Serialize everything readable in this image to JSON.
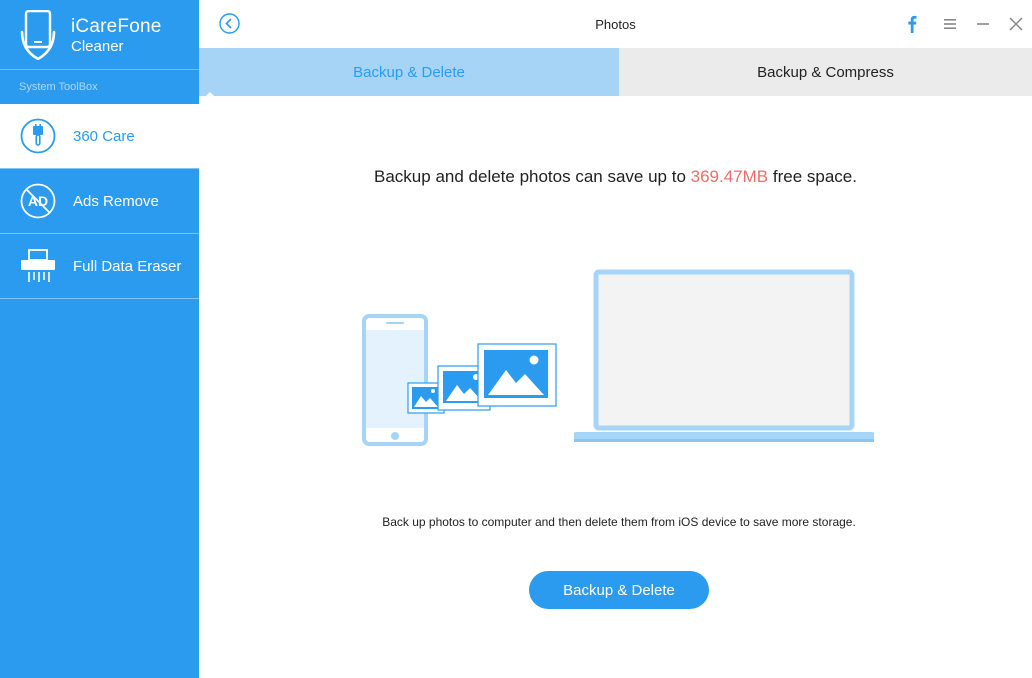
{
  "app": {
    "name": "iCareFone",
    "subtitle": "Cleaner"
  },
  "sidebar": {
    "section_label": "System ToolBox",
    "items": [
      {
        "label": "360 Care",
        "icon": "brush-icon",
        "active": true
      },
      {
        "label": "Ads Remove",
        "icon": "ad-block-icon",
        "active": false
      },
      {
        "label": "Full Data Eraser",
        "icon": "shredder-icon",
        "active": false
      }
    ]
  },
  "header": {
    "title": "Photos",
    "icons": [
      "back-icon",
      "facebook-icon",
      "menu-icon",
      "minimize-icon",
      "close-icon"
    ]
  },
  "tabs": [
    {
      "label": "Backup & Delete",
      "active": true
    },
    {
      "label": "Backup & Compress",
      "active": false
    }
  ],
  "main": {
    "headline_prefix": "Backup and delete photos can save up to ",
    "headline_size": "369.47MB",
    "headline_suffix": " free space.",
    "description": "Back up photos to computer and then delete them from iOS device to save more storage.",
    "action_label": "Backup & Delete"
  },
  "colors": {
    "accent": "#2b9bef",
    "tab_active_bg": "#a5d4f7",
    "tab_inactive_bg": "#ebebeb",
    "highlight": "#e9706b",
    "illustration": "#a5d4f7"
  }
}
